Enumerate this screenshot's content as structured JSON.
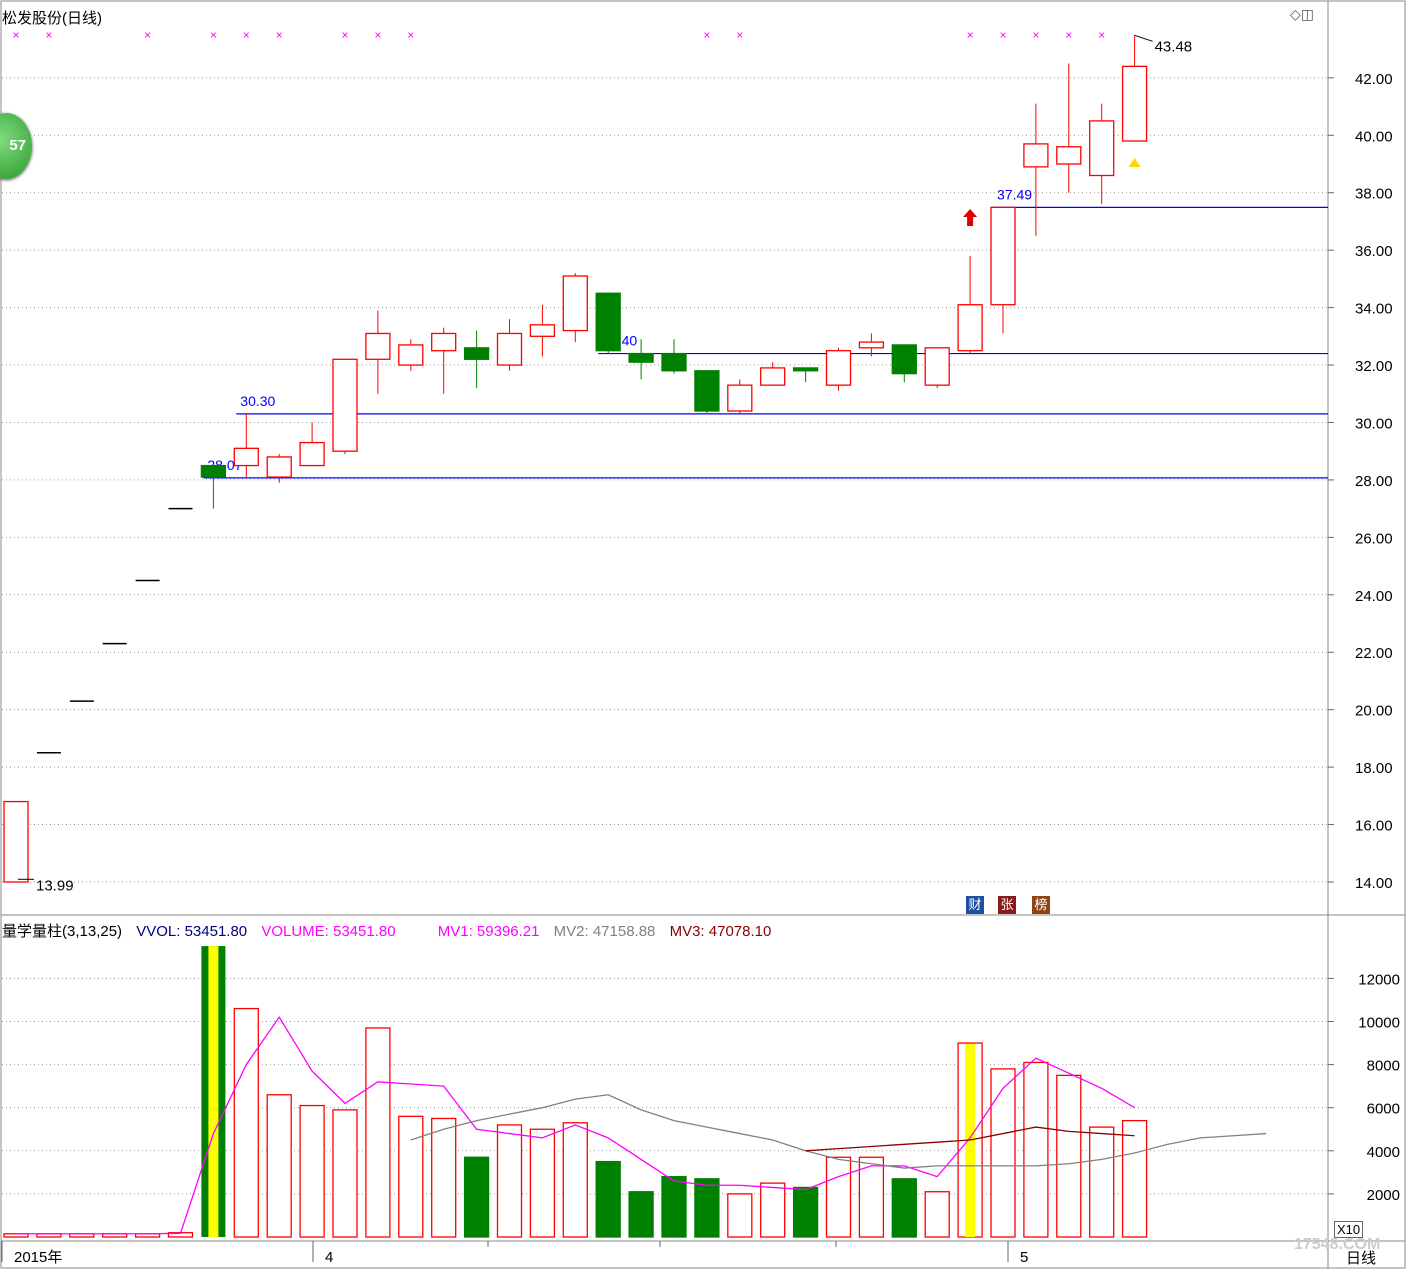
{
  "title": "松发股份(日线)",
  "window_controls": "◇◫",
  "side_indicator": "57",
  "badges": [
    "财",
    "张",
    "榜"
  ],
  "watermark": "17548.COM",
  "corner": {
    "scale": "X10",
    "period": "日线"
  },
  "volume_header": {
    "name": "量学量柱(3,13,25)",
    "vvol": "VVOL: 53451.80",
    "volume": "VOLUME: 53451.80",
    "mv1": "MV1: 59396.21",
    "mv2": "MV2: 47158.88",
    "mv3": "MV3: 47078.10"
  },
  "colors": {
    "up": "#ff0000",
    "down": "#008000",
    "level_line": "#0000ff",
    "mv1": "#ff00ff",
    "mv2": "#808080",
    "mv3": "#8b0000",
    "highlight": "#ffff00"
  },
  "chart_data": [
    {
      "type": "candlestick",
      "title": "松发股份(日线)",
      "ylim": [
        13.5,
        44
      ],
      "yticks": [
        "14.00",
        "16.00",
        "18.00",
        "20.00",
        "22.00",
        "24.00",
        "26.00",
        "28.00",
        "30.00",
        "32.00",
        "34.00",
        "36.00",
        "38.00",
        "40.00",
        "42.00"
      ],
      "x_labels": [
        "2015年",
        "4",
        "5"
      ],
      "grid": true,
      "candles": [
        {
          "o": 14.0,
          "h": 16.8,
          "l": 13.99,
          "c": 16.8
        },
        {
          "o": 18.5,
          "h": 18.5,
          "l": 18.5,
          "c": 18.5
        },
        {
          "o": 20.3,
          "h": 20.3,
          "l": 20.3,
          "c": 20.3
        },
        {
          "o": 22.3,
          "h": 22.3,
          "l": 22.3,
          "c": 22.3
        },
        {
          "o": 24.5,
          "h": 24.5,
          "l": 24.5,
          "c": 24.5
        },
        {
          "o": 27.0,
          "h": 27.0,
          "l": 27.0,
          "c": 27.0
        },
        {
          "o": 28.5,
          "h": 28.5,
          "l": 27.0,
          "c": 28.1
        },
        {
          "o": 28.5,
          "h": 30.3,
          "l": 28.1,
          "c": 29.1
        },
        {
          "o": 28.1,
          "h": 28.9,
          "l": 27.9,
          "c": 28.8
        },
        {
          "o": 28.5,
          "h": 30.0,
          "l": 28.5,
          "c": 29.3
        },
        {
          "o": 29.0,
          "h": 32.2,
          "l": 28.9,
          "c": 32.2
        },
        {
          "o": 32.2,
          "h": 33.9,
          "l": 31.0,
          "c": 33.1
        },
        {
          "o": 32.0,
          "h": 32.9,
          "l": 31.8,
          "c": 32.7
        },
        {
          "o": 32.5,
          "h": 33.3,
          "l": 31.0,
          "c": 33.1
        },
        {
          "o": 32.6,
          "h": 33.2,
          "l": 31.2,
          "c": 32.2
        },
        {
          "o": 32.0,
          "h": 33.6,
          "l": 31.8,
          "c": 33.1
        },
        {
          "o": 33.0,
          "h": 34.1,
          "l": 32.3,
          "c": 33.4
        },
        {
          "o": 33.2,
          "h": 35.2,
          "l": 32.8,
          "c": 35.1
        },
        {
          "o": 34.5,
          "h": 34.5,
          "l": 32.4,
          "c": 32.5
        },
        {
          "o": 32.4,
          "h": 32.9,
          "l": 31.5,
          "c": 32.1
        },
        {
          "o": 32.4,
          "h": 32.9,
          "l": 31.7,
          "c": 31.8
        },
        {
          "o": 31.8,
          "h": 31.8,
          "l": 30.3,
          "c": 30.4
        },
        {
          "o": 30.4,
          "h": 31.5,
          "l": 30.3,
          "c": 31.3
        },
        {
          "o": 31.3,
          "h": 32.1,
          "l": 31.3,
          "c": 31.9
        },
        {
          "o": 31.9,
          "h": 31.9,
          "l": 31.4,
          "c": 31.8
        },
        {
          "o": 31.3,
          "h": 32.6,
          "l": 31.1,
          "c": 32.5
        },
        {
          "o": 32.6,
          "h": 33.1,
          "l": 32.3,
          "c": 32.8
        },
        {
          "o": 32.7,
          "h": 32.7,
          "l": 31.4,
          "c": 31.7
        },
        {
          "o": 31.3,
          "h": 32.6,
          "l": 31.2,
          "c": 32.6
        },
        {
          "o": 32.5,
          "h": 35.8,
          "l": 32.4,
          "c": 34.1
        },
        {
          "o": 34.1,
          "h": 37.49,
          "l": 33.1,
          "c": 37.49
        },
        {
          "o": 38.9,
          "h": 41.1,
          "l": 36.5,
          "c": 39.7
        },
        {
          "o": 39.0,
          "h": 42.5,
          "l": 38.0,
          "c": 39.6
        },
        {
          "o": 38.6,
          "h": 41.1,
          "l": 37.6,
          "c": 40.5
        },
        {
          "o": 39.8,
          "h": 43.48,
          "l": 39.8,
          "c": 42.4
        }
      ],
      "levels": [
        {
          "value": 28.07,
          "label": "28.07",
          "from": 6
        },
        {
          "value": 30.3,
          "label": "30.30",
          "from": 7
        },
        {
          "value": 32.4,
          "label": "32.40",
          "from": 18
        },
        {
          "value": 37.49,
          "label": "37.49",
          "from": 30
        }
      ],
      "annotations": {
        "low": "13.99",
        "high": "43.48"
      },
      "star_markers": [
        0,
        1,
        4,
        6,
        7,
        8,
        10,
        11,
        12,
        21,
        22,
        29,
        30,
        31,
        32,
        33
      ]
    },
    {
      "type": "bar",
      "title": "量学量柱(3,13,25)",
      "ylim": [
        0,
        13500
      ],
      "yticks": [
        "2000",
        "4000",
        "6000",
        "8000",
        "10000",
        "12000"
      ],
      "values": [
        150,
        150,
        150,
        150,
        150,
        200,
        14000,
        10600,
        6600,
        6100,
        5900,
        9700,
        5600,
        5500,
        3700,
        5200,
        5000,
        5300,
        3500,
        2100,
        2800,
        2700,
        2000,
        2500,
        2300,
        3700,
        3700,
        2700,
        2100,
        9000,
        7800,
        8100,
        7500,
        5100,
        5400
      ],
      "up": [
        true,
        true,
        true,
        true,
        true,
        true,
        false,
        true,
        true,
        true,
        true,
        true,
        true,
        true,
        false,
        true,
        true,
        true,
        false,
        false,
        false,
        false,
        true,
        true,
        false,
        true,
        true,
        false,
        true,
        true,
        true,
        true,
        true,
        true,
        true
      ],
      "highlight": [
        6,
        29
      ],
      "series": [
        {
          "name": "MV1",
          "values": [
            150,
            150,
            150,
            150,
            150,
            170,
            4800,
            8000,
            10200,
            7700,
            6200,
            7200,
            7100,
            7000,
            5000,
            4800,
            4600,
            5200,
            4600,
            3600,
            2600,
            2400,
            2400,
            2300,
            2200,
            2800,
            3300,
            3300,
            2800,
            4600,
            6900,
            8300,
            7600,
            6900,
            6000
          ]
        },
        {
          "name": "MV2",
          "start": 12,
          "values": [
            4500,
            5000,
            5400,
            5700,
            6000,
            6400,
            6600,
            5900,
            5400,
            5100,
            4800,
            4500,
            4000,
            3600,
            3400,
            3200,
            3300,
            3300,
            3300,
            3300,
            3400,
            3600,
            3900,
            4300,
            4600,
            4700,
            4800
          ]
        },
        {
          "name": "MV3",
          "start": 24,
          "values": [
            4000,
            4100,
            4200,
            4300,
            4400,
            4500,
            4800,
            5100,
            4900,
            4800,
            4700
          ]
        }
      ]
    }
  ]
}
